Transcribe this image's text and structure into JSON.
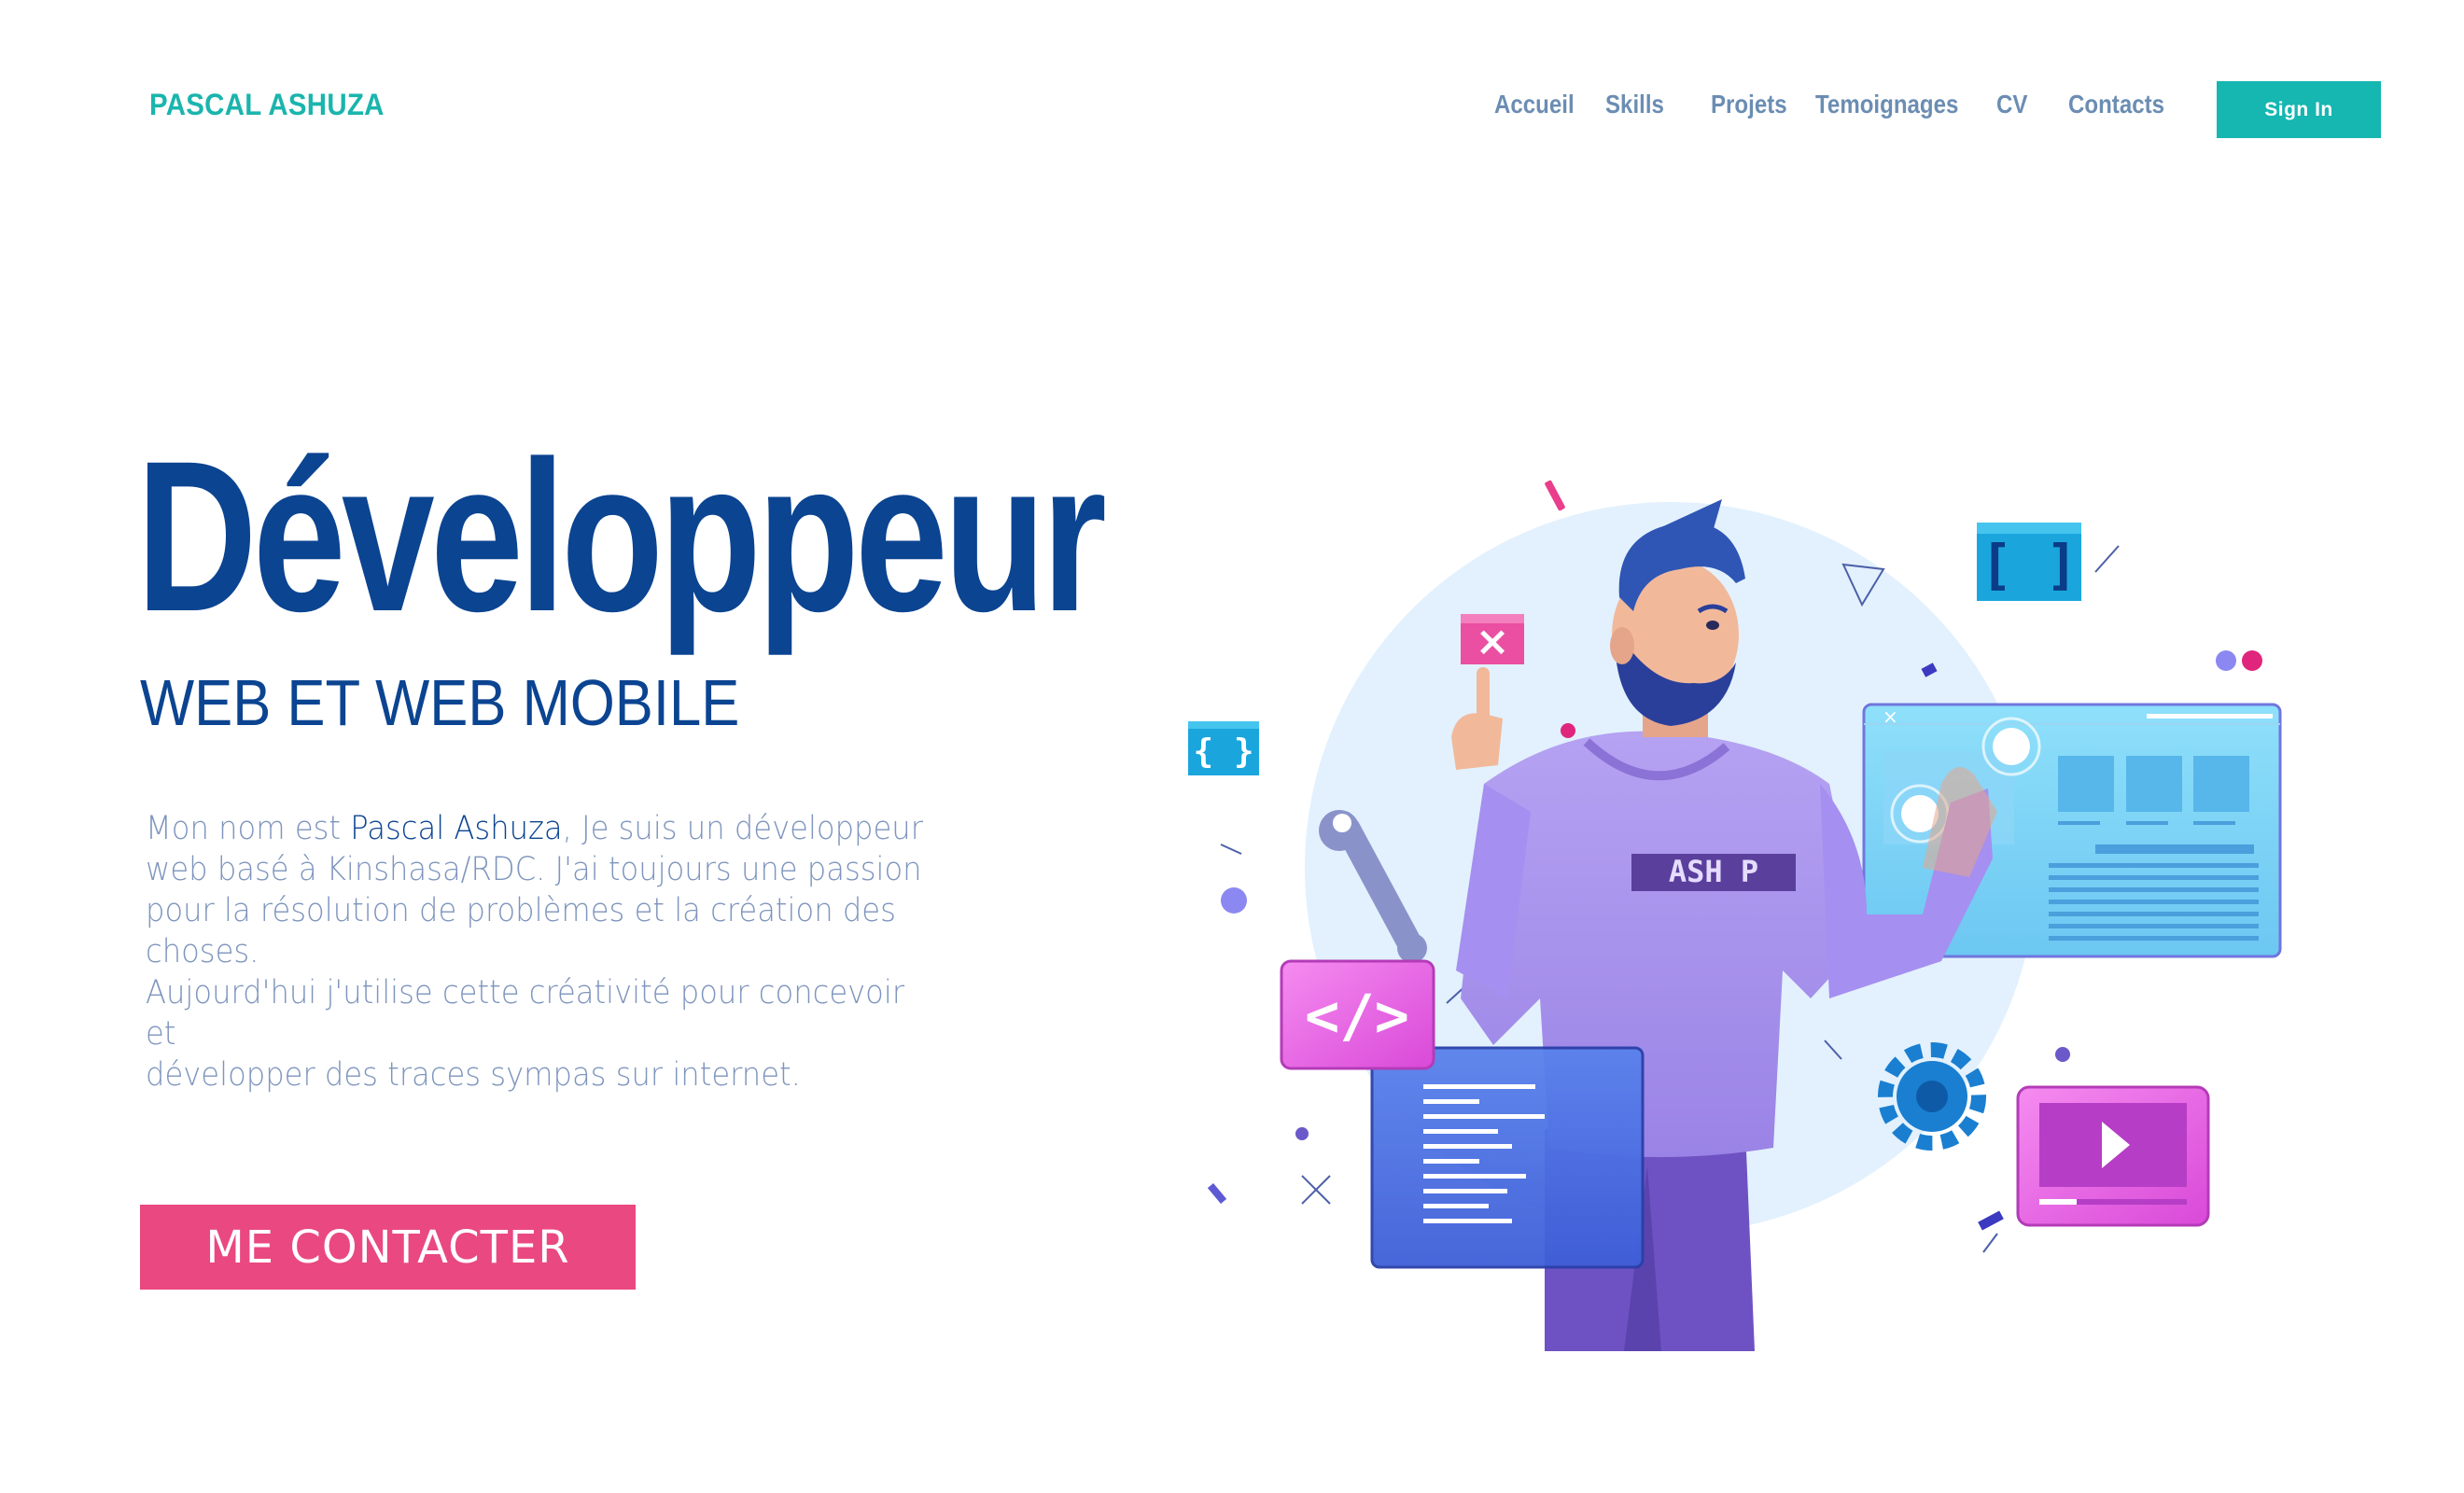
{
  "header": {
    "brand": "PASCAL ASHUZA",
    "nav": [
      {
        "label": "Accueil"
      },
      {
        "label": "Skills"
      },
      {
        "label": "Projets"
      },
      {
        "label": "Temoignages"
      },
      {
        "label": "CV"
      },
      {
        "label": "Contacts"
      }
    ],
    "signin_label": "Sign In"
  },
  "hero": {
    "title": "Développeur",
    "subtitle": "WEB ET WEB MOBILE",
    "intro": {
      "prefix": "Mon nom est ",
      "name": "Pascal Ashuza",
      "lines": [
        ", Je suis un développeur",
        "web basé à Kinshasa/RDC. J'ai toujours une passion",
        "pour la résolution de problèmes et la création des",
        "choses.",
        "Aujourd'hui j'utilise cette créativité pour concevoir et",
        "développer des traces sympas sur internet."
      ]
    },
    "cta_label": "ME CONTACTER"
  },
  "illustration": {
    "shirt_text": "ASH P",
    "icons": [
      "brackets-icon",
      "close-icon",
      "code-icon",
      "wrench-icon",
      "gear-icon",
      "play-icon"
    ]
  },
  "colors": {
    "brand": "#1ab5ad",
    "nav": "#6b8db3",
    "title": "#0b4491",
    "body_text": "#7e95bd",
    "cta": "#ea4880",
    "signin": "#16b6b1"
  }
}
